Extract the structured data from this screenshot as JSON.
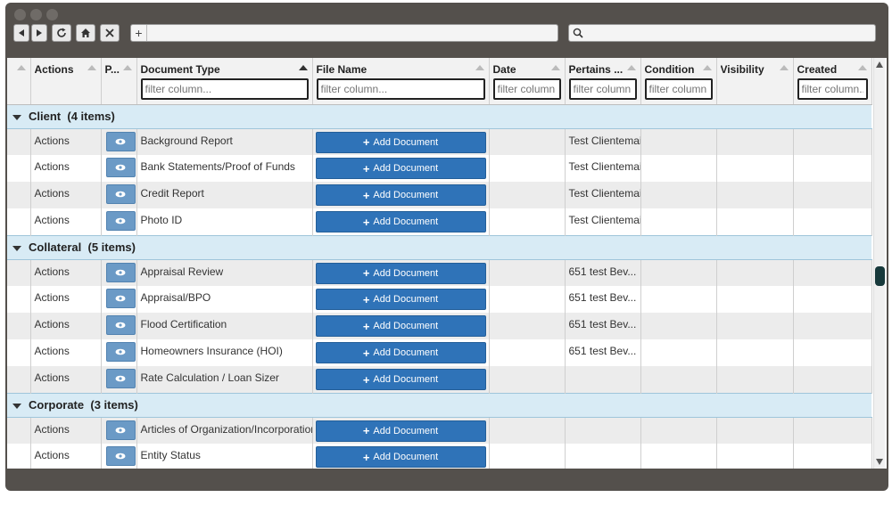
{
  "browser": {
    "address_plus": "+",
    "search_value": ""
  },
  "columns": [
    {
      "label": "",
      "filter": false
    },
    {
      "label": "Actions",
      "filter": false
    },
    {
      "label": "P...",
      "filter": false
    },
    {
      "label": "Document Type",
      "filter": true,
      "active_sort": true
    },
    {
      "label": "File Name",
      "filter": true
    },
    {
      "label": "Date",
      "filter": true
    },
    {
      "label": "Pertains ...",
      "filter": true
    },
    {
      "label": "Condition",
      "filter": true
    },
    {
      "label": "Visibility",
      "filter": false
    },
    {
      "label": "Created",
      "filter": true
    }
  ],
  "filter_placeholder": "filter column...",
  "narrow_filter_placeholder": "filter column",
  "groups": [
    {
      "label": "Client",
      "count": "(4 items)",
      "rows": [
        {
          "actions": "Actions",
          "doc_type": "Background Report",
          "pertains": "Test Clientemail"
        },
        {
          "actions": "Actions",
          "doc_type": "Bank Statements/Proof of Funds",
          "pertains": "Test Clientemail"
        },
        {
          "actions": "Actions",
          "doc_type": "Credit Report",
          "pertains": "Test Clientemail"
        },
        {
          "actions": "Actions",
          "doc_type": "Photo ID",
          "pertains": "Test Clientemail"
        }
      ]
    },
    {
      "label": "Collateral",
      "count": "(5 items)",
      "rows": [
        {
          "actions": "Actions",
          "doc_type": "Appraisal Review",
          "pertains": "651 test Bev..."
        },
        {
          "actions": "Actions",
          "doc_type": "Appraisal/BPO",
          "pertains": "651 test Bev..."
        },
        {
          "actions": "Actions",
          "doc_type": "Flood Certification",
          "pertains": "651 test Bev..."
        },
        {
          "actions": "Actions",
          "doc_type": "Homeowners Insurance (HOI)",
          "pertains": "651 test Bev..."
        },
        {
          "actions": "Actions",
          "doc_type": "Rate Calculation / Loan Sizer",
          "pertains": ""
        }
      ]
    },
    {
      "label": "Corporate",
      "count": "(3 items)",
      "rows": [
        {
          "actions": "Actions",
          "doc_type": "Articles of Organization/Incorporation",
          "pertains": ""
        },
        {
          "actions": "Actions",
          "doc_type": "Entity Status",
          "pertains": ""
        }
      ]
    }
  ],
  "add_document_label": "Add Document",
  "icons": {
    "back": "back-arrow-icon",
    "forward": "forward-arrow-icon",
    "reload": "reload-icon",
    "home": "home-icon",
    "close": "close-icon",
    "search": "search-icon",
    "preview": "eye-icon",
    "add": "plus-icon"
  }
}
